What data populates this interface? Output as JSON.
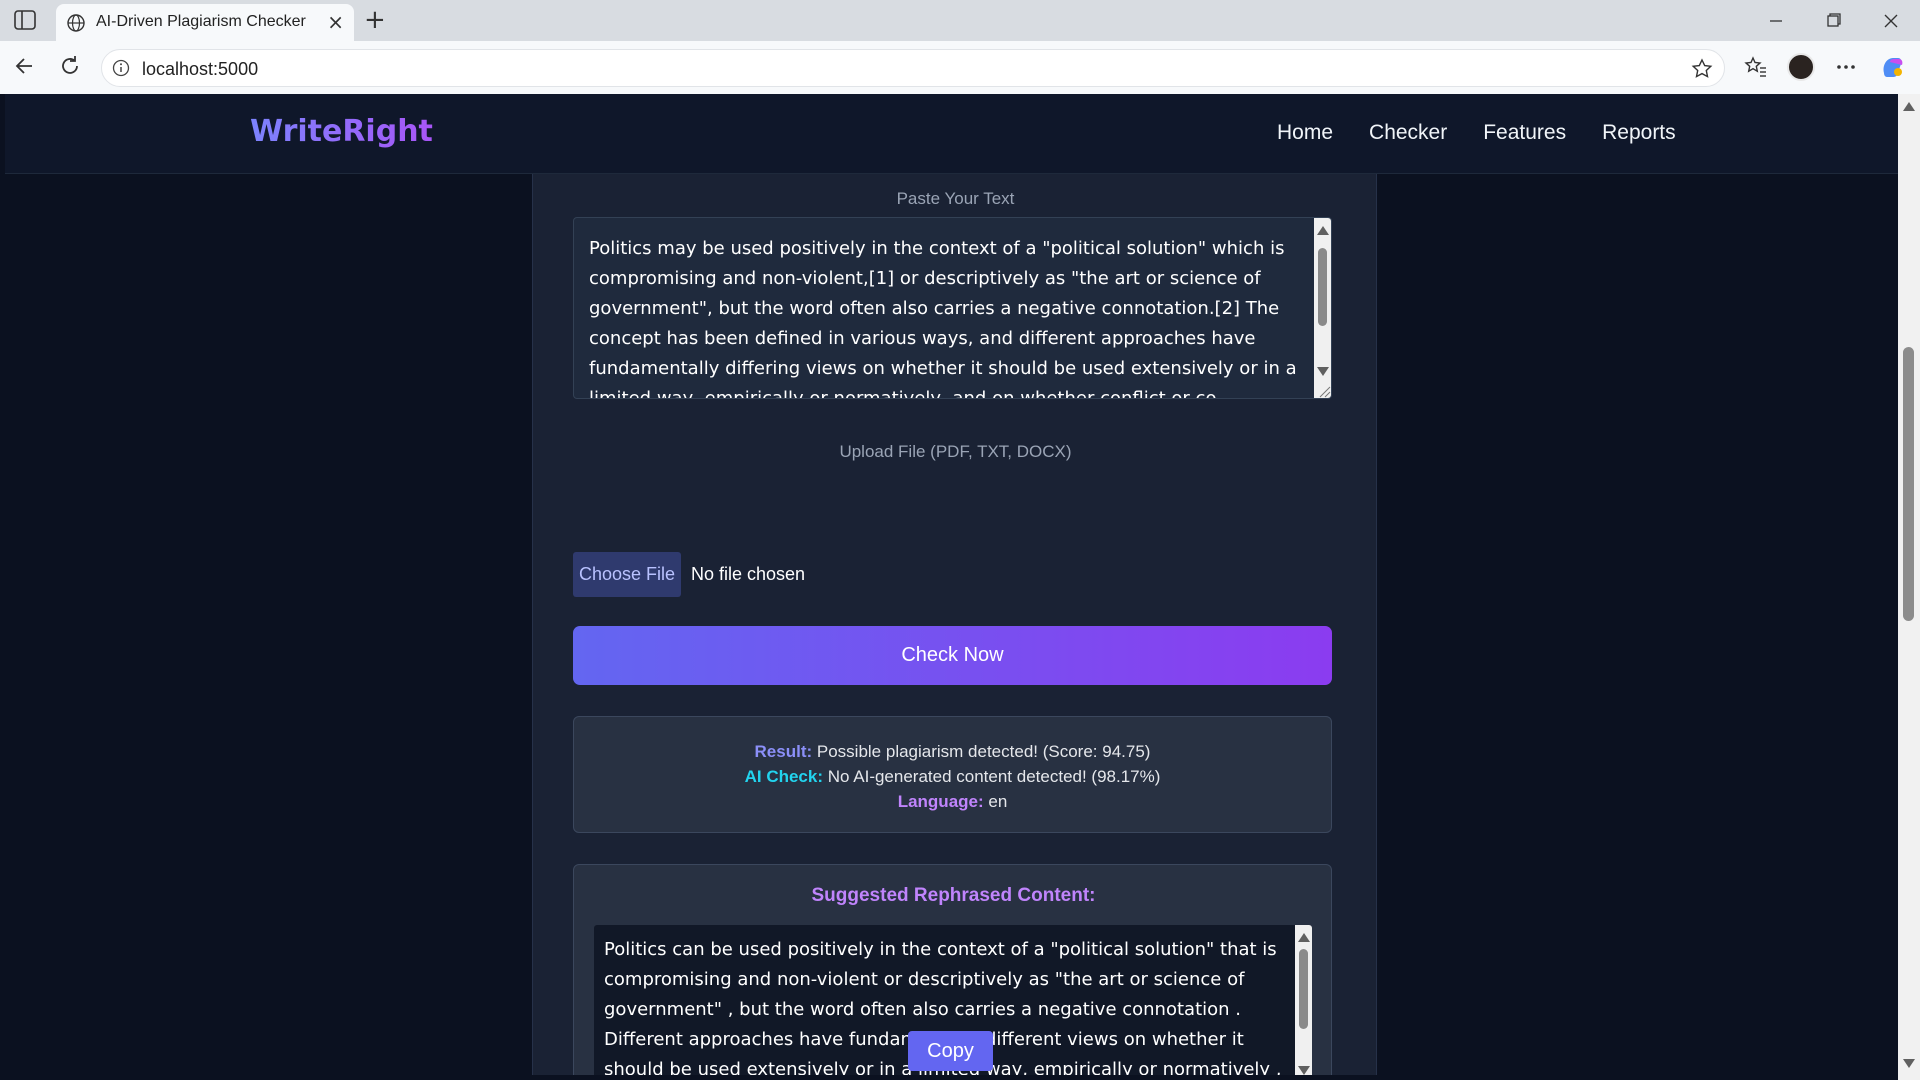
{
  "browser": {
    "tab_title": "AI-Driven Plagiarism Checker",
    "url": "localhost:5000",
    "icons": [
      "sidebar-toggle-icon",
      "globe-icon",
      "close-icon",
      "plus-icon",
      "back-icon",
      "reload-icon",
      "info-icon",
      "star-icon",
      "favorites-icon",
      "profile-avatar",
      "more-icon",
      "copilot-icon"
    ]
  },
  "navbar": {
    "logo": "WriteRight",
    "links": [
      "Home",
      "Checker",
      "Features",
      "Reports"
    ]
  },
  "checker": {
    "paste_label": "Paste Your Text",
    "input_text": "Politics may be used positively in the context of a \"political solution\" which is compromising and non-violent,[1] or descriptively as \"the art or science of government\", but the word often also carries a negative connotation.[2] The concept has been defined in various ways, and different approaches have fundamentally differing views on whether it should be used extensively or in a limited way, empirically or normatively, and on whether conflict or co-operation",
    "upload_label": "Upload File (PDF, TXT, DOCX)",
    "choose_file": "Choose File",
    "no_file": "No file chosen",
    "check_button": "Check Now"
  },
  "result": {
    "result_key": "Result:",
    "result_value": " Possible plagiarism detected! (Score: 94.75)",
    "ai_key": "AI Check:",
    "ai_value": " No AI-generated content detected! (98.17%)",
    "lang_key": "Language:",
    "lang_value": " en"
  },
  "rephrase": {
    "title": "Suggested Rephrased Content:",
    "text": "Politics can be used positively in the context of a \"political solution\" that is compromising and non-violent or descriptively as \"the art or science of government\" , but the word often also carries a negative connotation . Different approaches have fundamentally different views on whether it should be used extensively or in a limited way, empirically or normatively , and whether conflict or co-operation is more central to politics .",
    "copy_button": "Copy"
  },
  "colors": {
    "accent": "#6366f1",
    "accent2": "#8b3cf0",
    "bg": "#0b1120",
    "panel": "#1a2234"
  }
}
